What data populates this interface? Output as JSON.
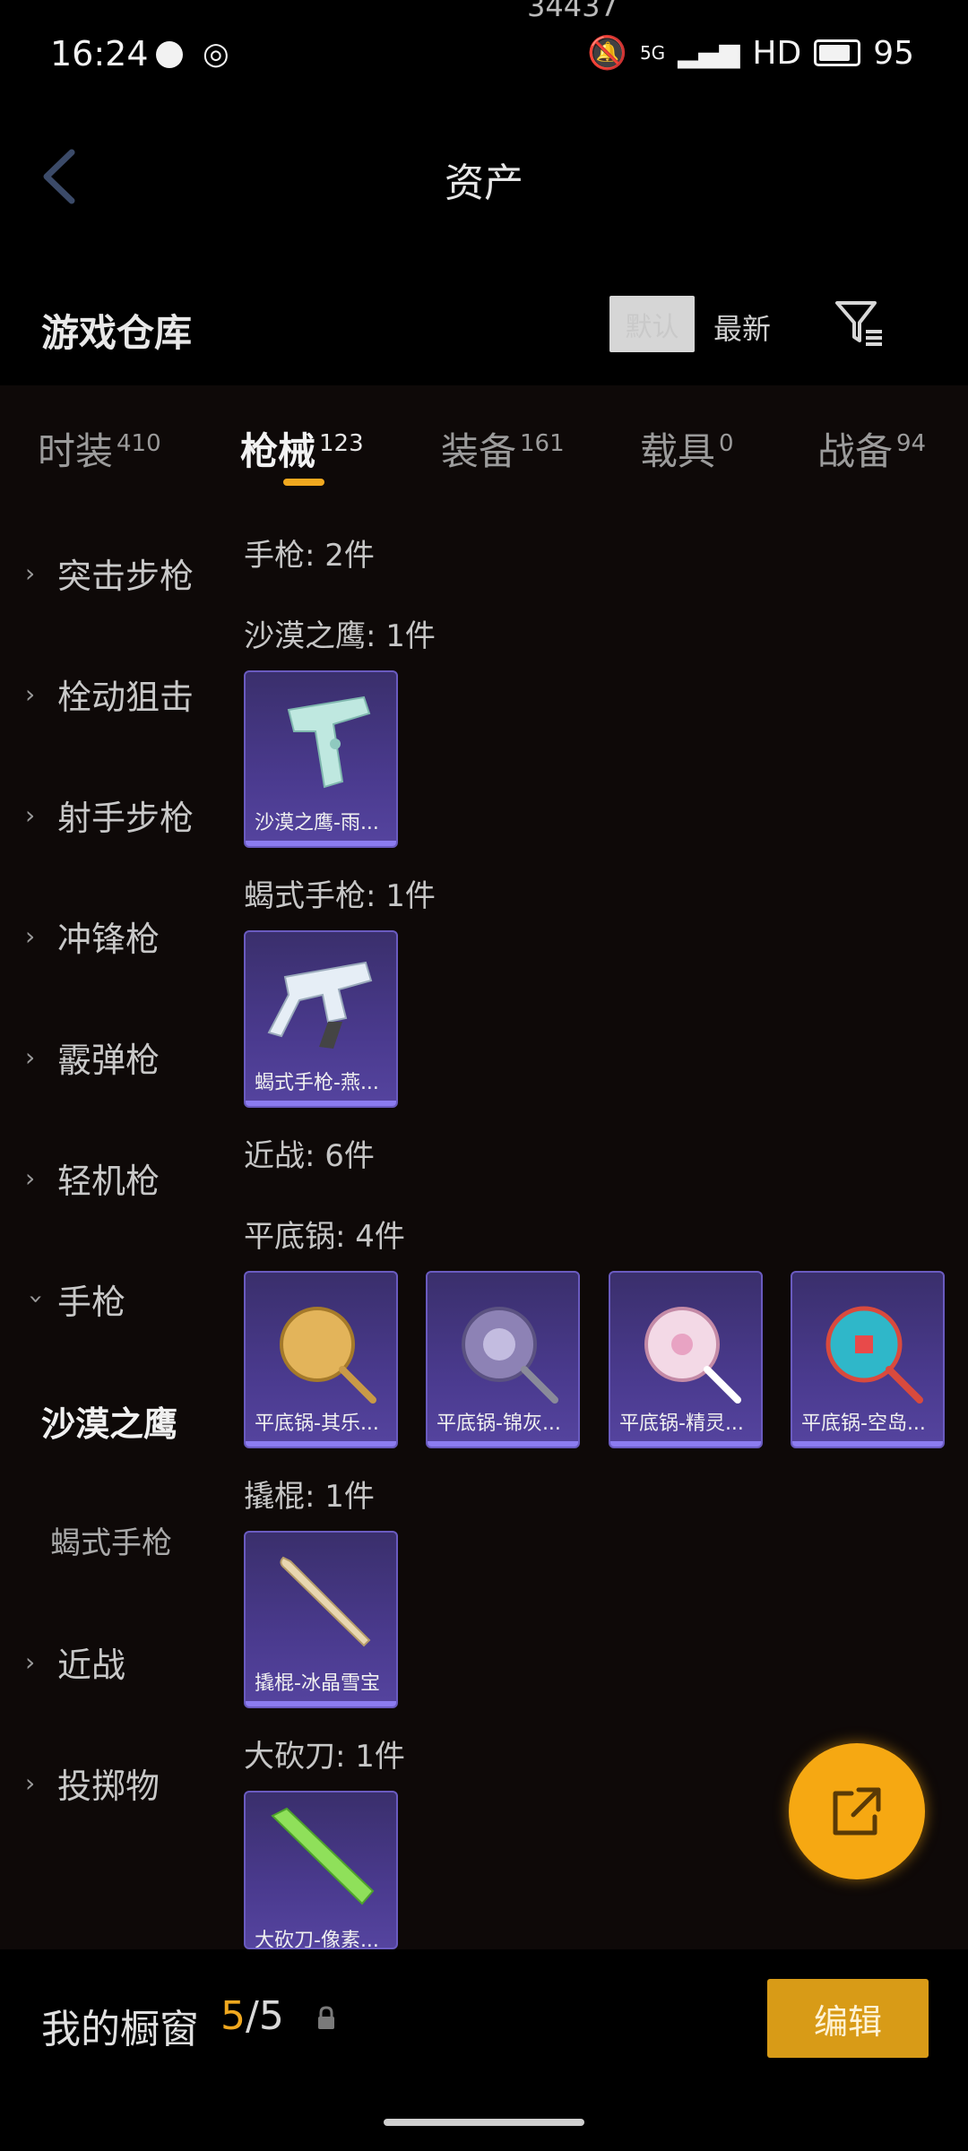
{
  "status": {
    "time": "16:24",
    "signal": "5G",
    "hd": "HD",
    "battery": "95",
    "top_text": "34437"
  },
  "nav": {
    "title": "资产"
  },
  "header": {
    "title": "游戏仓库",
    "sort_selected": "默认",
    "sort_newest": "最新"
  },
  "tabs": [
    {
      "label": "时装",
      "count": "410"
    },
    {
      "label": "枪械",
      "count": "123"
    },
    {
      "label": "装备",
      "count": "161"
    },
    {
      "label": "载具",
      "count": "0"
    },
    {
      "label": "战备",
      "count": "94"
    }
  ],
  "sidebar": {
    "items": [
      {
        "label": "突击步枪"
      },
      {
        "label": "栓动狙击"
      },
      {
        "label": "射手步枪"
      },
      {
        "label": "冲锋枪"
      },
      {
        "label": "霰弹枪"
      },
      {
        "label": "轻机枪"
      },
      {
        "label": "手枪"
      },
      {
        "label": "近战"
      },
      {
        "label": "投掷物"
      }
    ],
    "sub_items": [
      {
        "label": "沙漠之鹰"
      },
      {
        "label": "蝎式手枪"
      }
    ]
  },
  "content": {
    "pistol_header": "手枪: 2件",
    "deagle_header": "沙漠之鹰: 1件",
    "deagle_item": "沙漠之鹰-雨...",
    "scorpion_header": "蝎式手枪: 1件",
    "scorpion_item": "蝎式手枪-燕...",
    "melee_header": "近战: 6件",
    "pan_header": "平底锅: 4件",
    "pan_items": [
      "平底锅-其乐...",
      "平底锅-锦灰...",
      "平底锅-精灵...",
      "平底锅-空岛..."
    ],
    "crowbar_header": "撬棍: 1件",
    "crowbar_item": "撬棍-冰晶雪宝",
    "machete_header": "大砍刀: 1件",
    "machete_item": "大砍刀-像素..."
  },
  "bottom": {
    "title": "我的橱窗",
    "count_current": "5",
    "count_total": "/5",
    "edit_label": "编辑"
  },
  "colors": {
    "accent": "#f0a81f",
    "card": "#4a3a8e",
    "fab": "#f6a812"
  }
}
